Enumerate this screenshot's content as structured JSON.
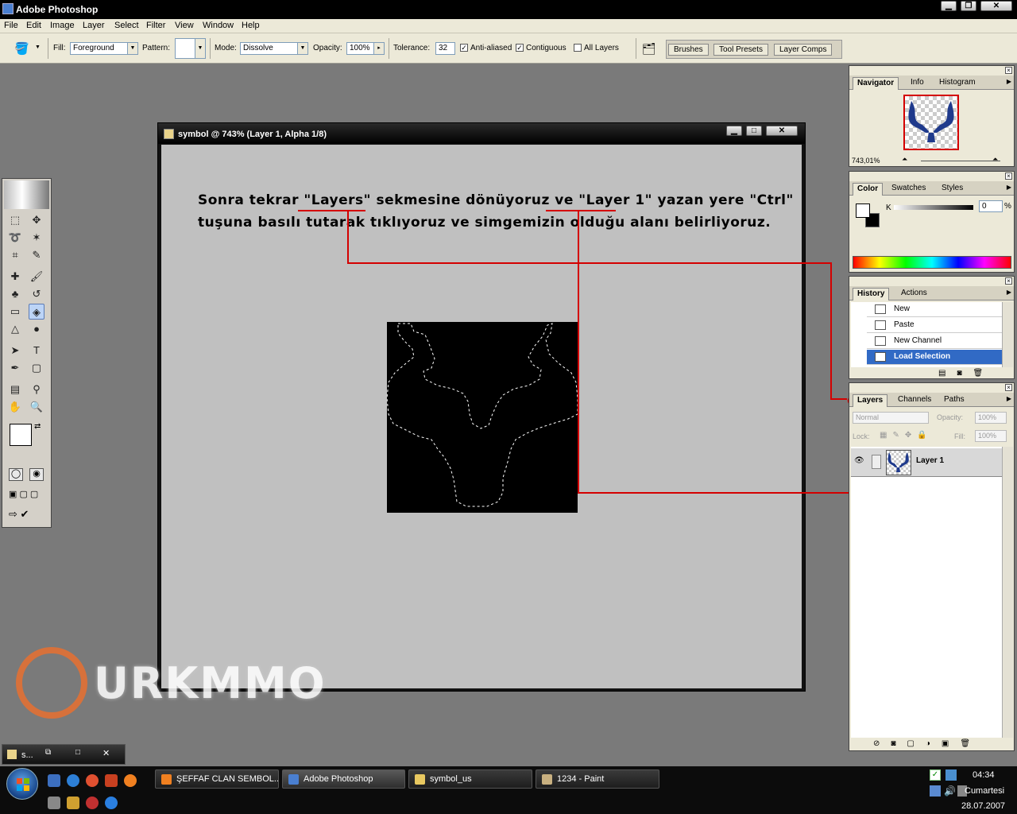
{
  "app": {
    "title": "Adobe Photoshop"
  },
  "menu": [
    "File",
    "Edit",
    "Image",
    "Layer",
    "Select",
    "Filter",
    "View",
    "Window",
    "Help"
  ],
  "options": {
    "fill_label": "Fill:",
    "fill_value": "Foreground",
    "pattern_label": "Pattern:",
    "mode_label": "Mode:",
    "mode_value": "Dissolve",
    "opacity_label": "Opacity:",
    "opacity_value": "100%",
    "tolerance_label": "Tolerance:",
    "tolerance_value": "32",
    "anti_aliased": "Anti-aliased",
    "contiguous": "Contiguous",
    "all_layers": "All Layers",
    "check": "✓"
  },
  "palette_well": [
    "Brushes",
    "Tool Presets",
    "Layer Comps"
  ],
  "document": {
    "title": "symbol @ 743% (Layer 1, Alpha 1/8)",
    "line1": "Sonra tekrar \"Layers\" sekmesine dönüyoruz ve \"Layer 1\" yazan yere \"Ctrl\"",
    "line2": "tuşuna basılı tutarak tıklıyoruz ve simgemizin olduğu alanı belirliyoruz."
  },
  "navigator": {
    "tabs": [
      "Navigator",
      "Info",
      "Histogram"
    ],
    "zoom": "743,01%"
  },
  "color": {
    "tabs": [
      "Color",
      "Swatches",
      "Styles"
    ],
    "channel": "K",
    "value": "0",
    "unit": "%"
  },
  "history": {
    "tabs": [
      "History",
      "Actions"
    ],
    "items": [
      "New",
      "Paste",
      "New Channel",
      "Load Selection"
    ]
  },
  "layers": {
    "tabs": [
      "Layers",
      "Channels",
      "Paths"
    ],
    "blend": "Normal",
    "opacity_label": "Opacity:",
    "opacity": "100%",
    "lock_label": "Lock:",
    "fill_label": "Fill:",
    "fill": "100%",
    "layer_name": "Layer 1"
  },
  "minimized": {
    "label": "s..."
  },
  "watermark": "URKMMO",
  "taskbar": {
    "buttons": [
      "ŞEFFAF CLAN SEMBOL...",
      "Adobe Photoshop",
      "symbol_us",
      "1234 - Paint"
    ],
    "time": "04:34",
    "day": "Cumartesi",
    "date": "28.07.2007"
  },
  "colors": {
    "annotation": "#d40000",
    "selection": "#316ac5"
  }
}
